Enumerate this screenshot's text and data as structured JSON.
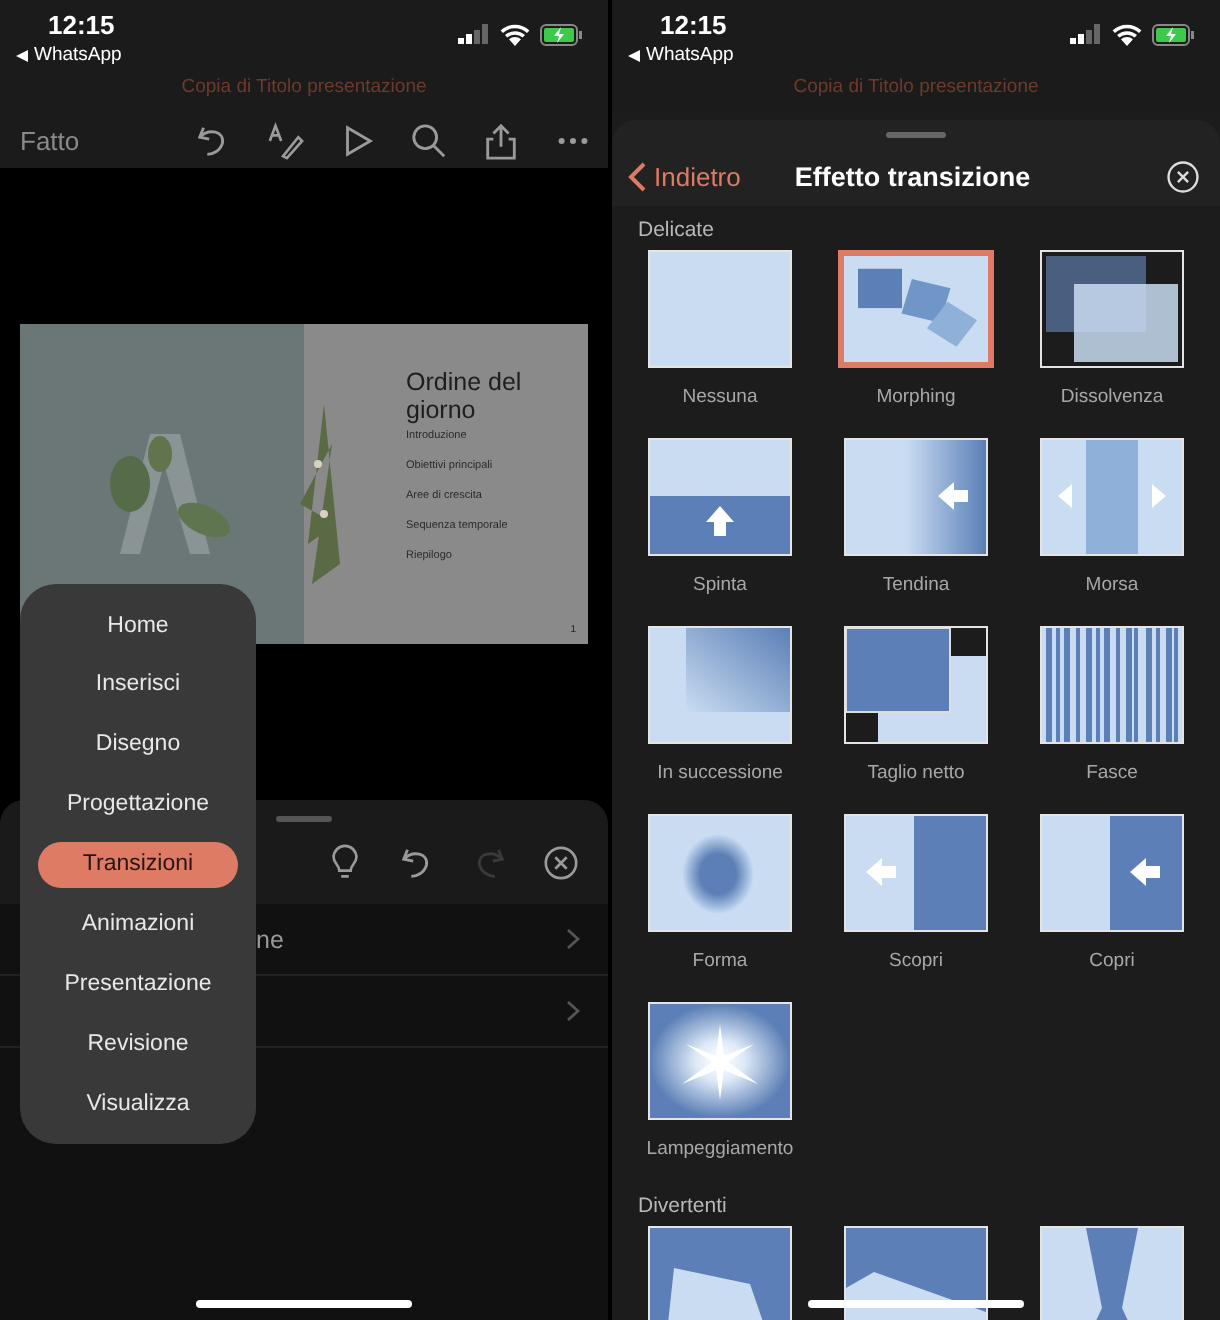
{
  "left": {
    "status": {
      "time": "12:15",
      "back_app": "WhatsApp"
    },
    "document_title": "Copia di Titolo presentazione",
    "toolbar": {
      "done": "Fatto"
    },
    "slide": {
      "title": "Ordine del giorno",
      "items": [
        "Introduzione",
        "Obiettivi principali",
        "Aree di crescita",
        "Sequenza temporale",
        "Riepilogo"
      ],
      "page": "1"
    },
    "sheet": {
      "redo_disabled": true,
      "rows": [
        {
          "kind": "text",
          "text": "ne"
        },
        {
          "kind": "empty"
        }
      ]
    },
    "menu": [
      {
        "label": "Home",
        "selected": false
      },
      {
        "label": "Inserisci",
        "selected": false
      },
      {
        "label": "Disegno",
        "selected": false
      },
      {
        "label": "Progettazione",
        "selected": false
      },
      {
        "label": "Transizioni",
        "selected": true
      },
      {
        "label": "Animazioni",
        "selected": false
      },
      {
        "label": "Presentazione",
        "selected": false
      },
      {
        "label": "Revisione",
        "selected": false
      },
      {
        "label": "Visualizza",
        "selected": false
      }
    ]
  },
  "right": {
    "status": {
      "time": "12:15",
      "back_app": "WhatsApp"
    },
    "document_title": "Copia di Titolo presentazione",
    "sheet": {
      "back": "Indietro",
      "title": "Effetto transizione",
      "sections": [
        {
          "title": "Delicate",
          "effects": [
            {
              "name": "Nessuna",
              "kind": "none",
              "selected": false
            },
            {
              "name": "Morphing",
              "kind": "morph",
              "selected": true
            },
            {
              "name": "Dissolvenza",
              "kind": "fade",
              "selected": false
            },
            {
              "name": "Spinta",
              "kind": "push",
              "selected": false
            },
            {
              "name": "Tendina",
              "kind": "wipe",
              "selected": false
            },
            {
              "name": "Morsa",
              "kind": "split",
              "selected": false
            },
            {
              "name": "In successione",
              "kind": "succession",
              "selected": false
            },
            {
              "name": "Taglio netto",
              "kind": "cut",
              "selected": false
            },
            {
              "name": "Fasce",
              "kind": "bars",
              "selected": false
            },
            {
              "name": "Forma",
              "kind": "shape",
              "selected": false
            },
            {
              "name": "Scopri",
              "kind": "reveal",
              "selected": false
            },
            {
              "name": "Copri",
              "kind": "cover",
              "selected": false
            },
            {
              "name": "Lampeggiamento",
              "kind": "flash",
              "selected": false
            }
          ]
        },
        {
          "title": "Divertenti",
          "effects": [
            {
              "kind": "fall",
              "selected": false
            },
            {
              "kind": "peel",
              "selected": false
            },
            {
              "kind": "curtain",
              "selected": false
            }
          ]
        }
      ]
    }
  }
}
